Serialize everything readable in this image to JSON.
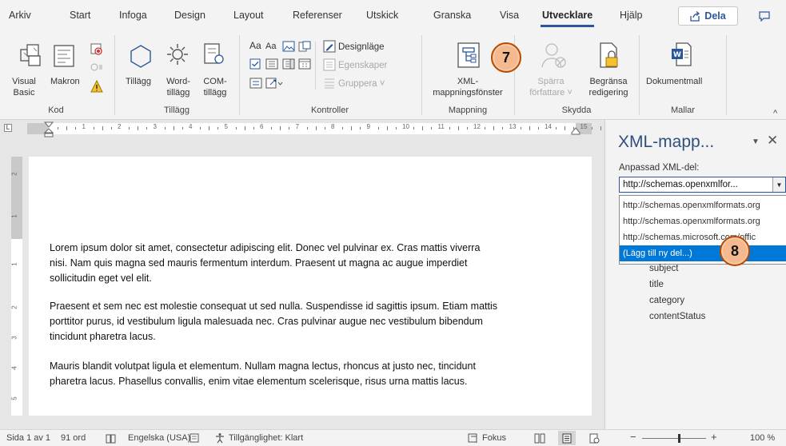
{
  "tabs": [
    "Arkiv",
    "Start",
    "Infoga",
    "Design",
    "Layout",
    "Referenser",
    "Utskick",
    "Granska",
    "Visa",
    "Utvecklare",
    "Hjälp"
  ],
  "active_tab": "Utvecklare",
  "share_label": "Dela",
  "ribbon": {
    "kod": {
      "label": "Kod",
      "visual_basic": [
        "Visual",
        "Basic"
      ],
      "makron": "Makron"
    },
    "tillagg": {
      "label": "Tillägg",
      "tillagg": "Tillägg",
      "word": [
        "Word-",
        "tillägg"
      ],
      "com": [
        "COM-",
        "tillägg"
      ]
    },
    "kontroller": {
      "label": "Kontroller",
      "designlage": "Designläge",
      "egenskaper": "Egenskaper",
      "gruppera": "Gruppera"
    },
    "mappning": {
      "label": "Mappning",
      "xml": [
        "XML-",
        "mappningsfönster"
      ]
    },
    "skydda": {
      "label": "Skydda",
      "sparra": [
        "Spärra",
        "författare"
      ],
      "begransa": [
        "Begränsa",
        "redigering"
      ]
    },
    "mallar": {
      "label": "Mallar",
      "dokumentmall": "Dokumentmall"
    }
  },
  "document": {
    "paragraphs": [
      [
        "Lorem ipsum dolor sit amet, consectetur adipiscing elit. Donec vel pulvinar ex. Cras mattis viverra",
        "nisi. Nam quis magna sed mauris fermentum interdum. Praesent ut magna ac augue imperdiet",
        "sollicitudin eget vel elit."
      ],
      [
        "Praesent et sem nec est molestie consequat ut sed nulla. Suspendisse id sagittis ipsum. Etiam mattis",
        "porttitor purus, id vestibulum ligula malesuada nec. Cras pulvinar augue nec vestibulum bibendum",
        "tincidunt pharetra lacus."
      ],
      [
        "Mauris blandit volutpat ligula et elementum. Nullam magna lectus, rhoncus at justo nec, tincidunt",
        "pharetra lacus. Phasellus convallis, enim vitae elementum scelerisque, risus urna mattis lacus."
      ]
    ]
  },
  "xml_pane": {
    "title": "XML-mapp...",
    "custom_label": "Anpassad XML-del:",
    "combo_value": "http://schemas.openxmlfor...",
    "options": [
      "http://schemas.openxmlformats.org",
      "http://schemas.openxmlformats.org",
      "http://schemas.microsoft.com/offic",
      "(Lägg till ny del...)"
    ],
    "tree": [
      "subject",
      "title",
      "category",
      "contentStatus"
    ]
  },
  "callouts": [
    "7",
    "8"
  ],
  "status": {
    "page": "Sida 1 av 1",
    "words": "91 ord",
    "language": "Engelska (USA)",
    "accessibility": "Tillgänglighet: Klart",
    "focus": "Fokus",
    "zoom": "100 %"
  },
  "ruler_numbers": [
    "1",
    "2",
    "3",
    "4",
    "5",
    "6",
    "7",
    "8",
    "9",
    "10",
    "11",
    "12",
    "13",
    "14",
    "15"
  ],
  "vruler_numbers": [
    "2",
    "1",
    "1",
    "2",
    "3",
    "4",
    "5"
  ]
}
